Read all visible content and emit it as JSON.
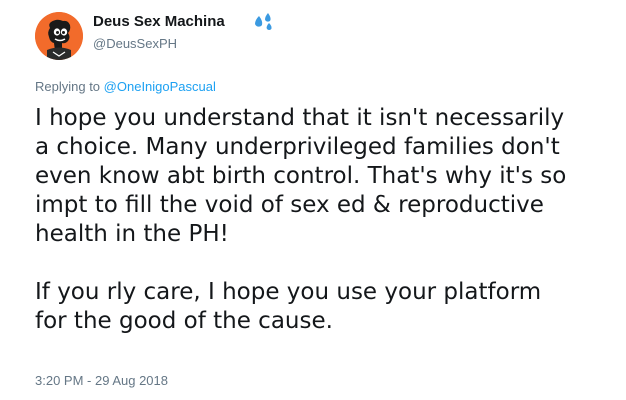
{
  "author": {
    "display_name": "Deus Sex Machina",
    "handle": "@DeusSexPH",
    "avatar_icon": "cartoon-character-avatar",
    "avatar_bg": "#f26b2b",
    "name_emoji_icon": "sweat-droplets-icon"
  },
  "reply": {
    "prefix": "Replying to",
    "mention": "@OneInigoPascual"
  },
  "tweet": {
    "paragraph_1": "I hope you understand that it isn't necessarily\na choice. Many underprivileged families don't\neven know abt birth control. That's why it's so\nimpt to fill the void of sex ed & reproductive\nhealth in the PH!",
    "paragraph_2": "If you rly care, I hope you use your platform\nfor the good of the cause.",
    "timestamp": "3:20 PM - 29 Aug 2018"
  },
  "colors": {
    "text": "#14171a",
    "secondary": "#657786",
    "link": "#1da1f2"
  }
}
